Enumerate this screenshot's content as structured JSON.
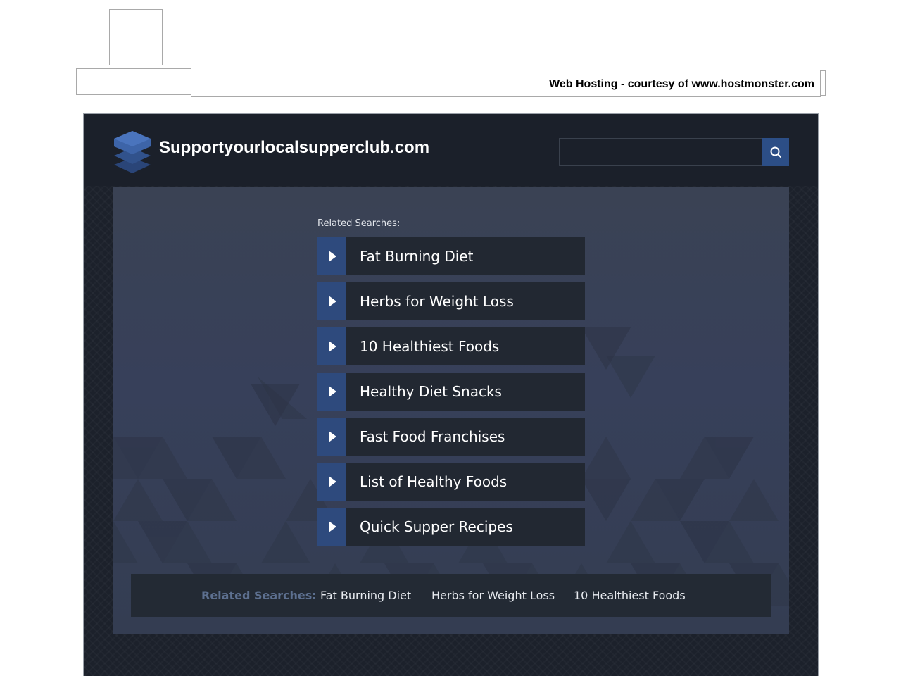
{
  "hosting_banner": {
    "text": "Web Hosting - courtesy of www.hostmonster.com"
  },
  "header": {
    "site_title": "Supportyourlocalsupperclub.com",
    "logo_icon": "stacked-layers-icon",
    "search": {
      "placeholder": "",
      "value": "",
      "button_icon": "search-icon"
    }
  },
  "main": {
    "related_heading": "Related Searches:",
    "links": [
      {
        "label": "Fat Burning Diet",
        "icon": "play-arrow-icon"
      },
      {
        "label": "Herbs for Weight Loss",
        "icon": "play-arrow-icon"
      },
      {
        "label": "10 Healthiest Foods",
        "icon": "play-arrow-icon"
      },
      {
        "label": "Healthy Diet Snacks",
        "icon": "play-arrow-icon"
      },
      {
        "label": "Fast Food Franchises",
        "icon": "play-arrow-icon"
      },
      {
        "label": "List of Healthy Foods",
        "icon": "play-arrow-icon"
      },
      {
        "label": "Quick Supper Recipes",
        "icon": "play-arrow-icon"
      }
    ]
  },
  "bottom_bar": {
    "heading": "Related Searches:",
    "links": [
      "Fat Burning Diet",
      "Herbs for Weight Loss",
      "10 Healthiest Foods"
    ]
  },
  "colors": {
    "accent": "#2e4a7d",
    "header_bg": "#1b202a",
    "content_bg": "#3a4254",
    "link_bg": "#222832"
  }
}
